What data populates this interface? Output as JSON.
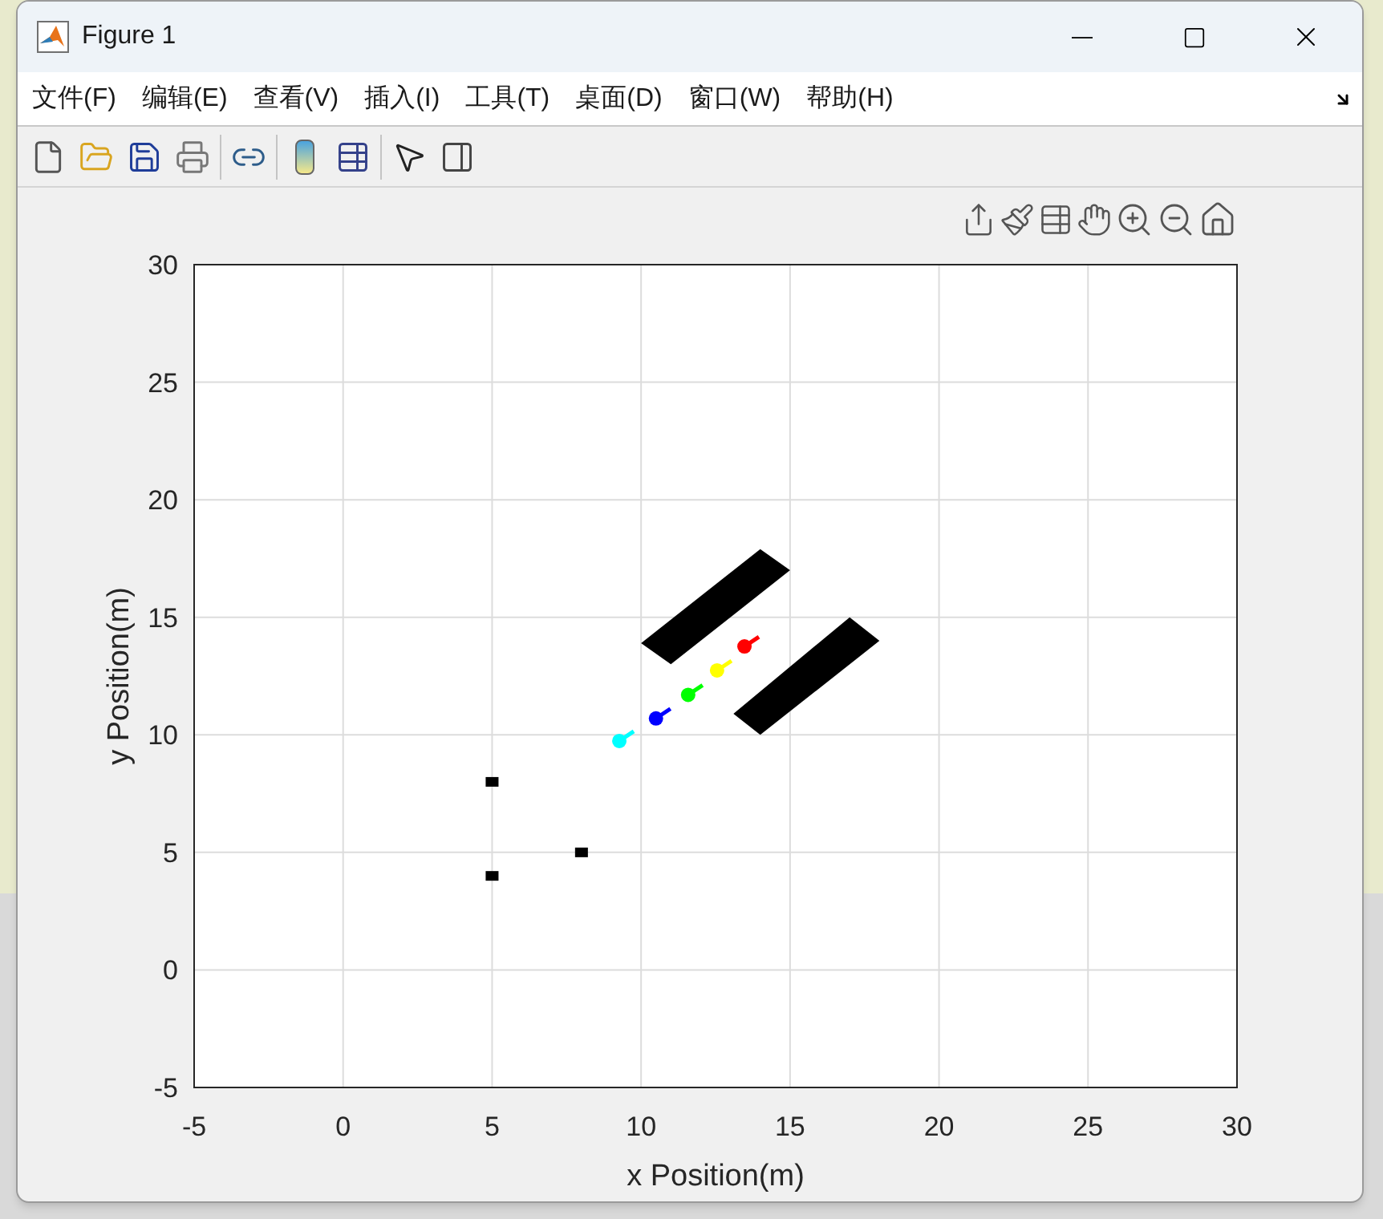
{
  "window": {
    "title": "Figure 1"
  },
  "menu": [
    "文件(F)",
    "编辑(E)",
    "查看(V)",
    "插入(I)",
    "工具(T)",
    "桌面(D)",
    "窗口(W)",
    "帮助(H)"
  ],
  "axes": {
    "chart_data": {
      "type": "scatter",
      "xlabel": "x Position(m)",
      "ylabel": "y Position(m)",
      "grid": true,
      "xlim": [
        -5,
        30
      ],
      "ylim": [
        -5,
        30
      ],
      "xticks": [
        -5,
        0,
        5,
        10,
        15,
        20,
        25,
        30
      ],
      "yticks": [
        -5,
        0,
        5,
        10,
        15,
        20,
        25,
        30
      ],
      "series": [
        {
          "marker": "square",
          "color": "#000000",
          "x": [
            5,
            5,
            8
          ],
          "values": [
            8,
            4,
            5
          ]
        },
        {
          "marker": "circle",
          "color": "#00ffff",
          "x": [
            9.27
          ],
          "values": [
            9.74
          ]
        },
        {
          "marker": "circle",
          "color": "#0000ff",
          "x": [
            10.5
          ],
          "values": [
            10.7
          ]
        },
        {
          "marker": "circle",
          "color": "#00ff00",
          "x": [
            11.58
          ],
          "values": [
            11.7
          ]
        },
        {
          "marker": "circle",
          "color": "#ffff00",
          "x": [
            12.55
          ],
          "values": [
            12.74
          ]
        },
        {
          "marker": "circle",
          "color": "#ff0000",
          "x": [
            13.47
          ],
          "values": [
            13.76
          ]
        },
        {
          "type": "area",
          "color": "#000000",
          "x": [
            10,
            14,
            15,
            11
          ],
          "values": [
            13.9,
            17.9,
            17,
            13
          ]
        },
        {
          "type": "area",
          "color": "#000000",
          "x": [
            13.1,
            17,
            18,
            14
          ],
          "values": [
            10.9,
            15,
            14,
            10
          ]
        }
      ]
    }
  }
}
